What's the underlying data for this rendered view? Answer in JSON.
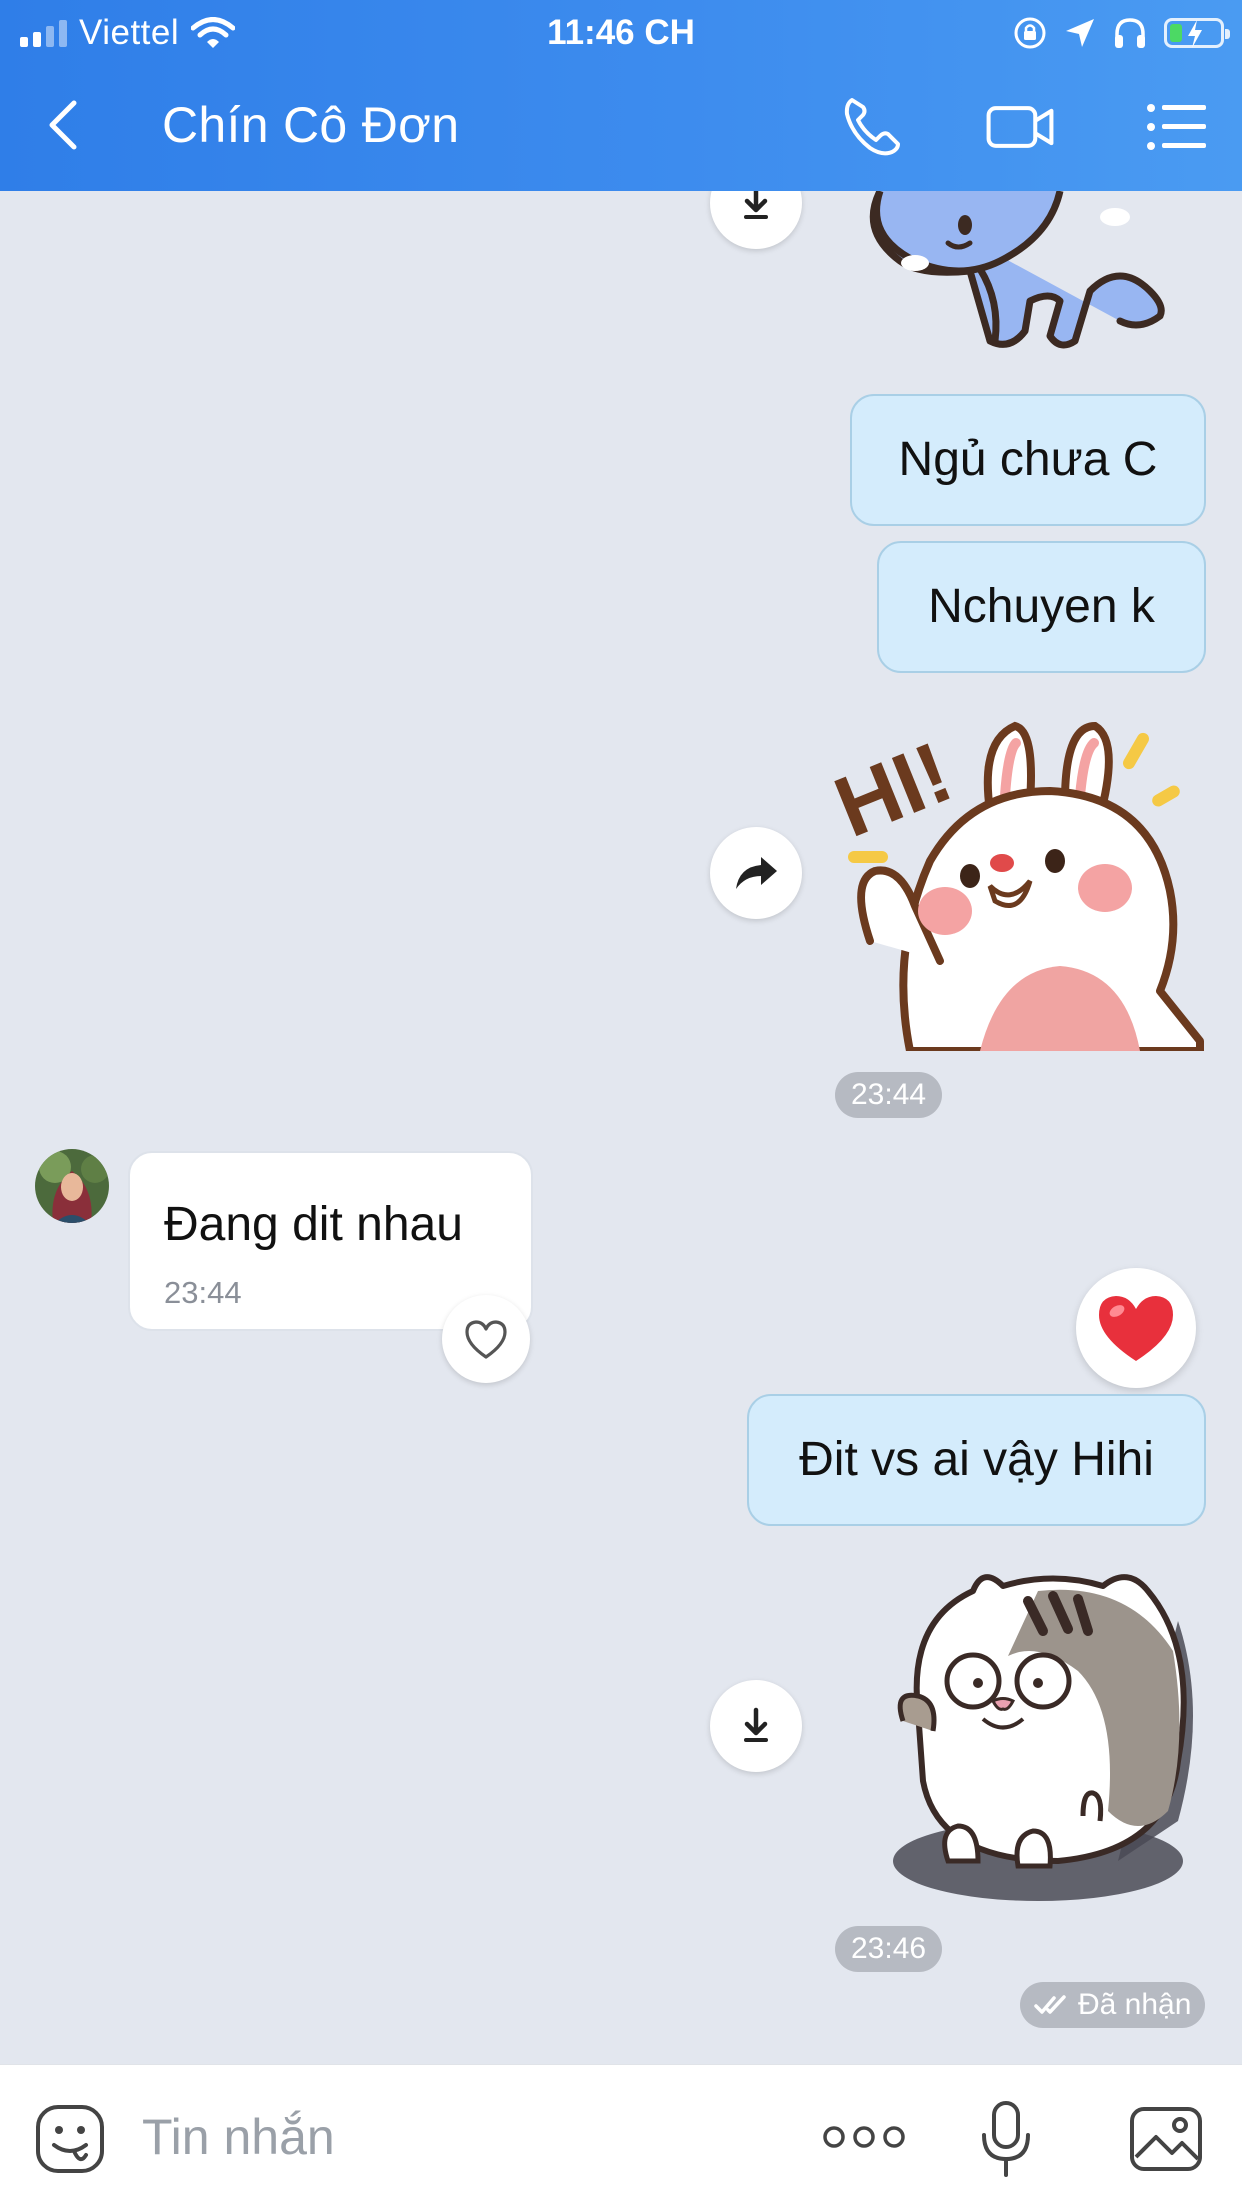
{
  "status_bar": {
    "carrier": "Viettel",
    "time": "11:46 CH"
  },
  "header": {
    "title": "Chín Cô Đơn",
    "icons": [
      "back-icon",
      "phone-icon",
      "video-camera-icon",
      "menu-list-icon"
    ]
  },
  "messages": {
    "out_1": "Ngủ chưa C",
    "out_2": "Nchuyen k",
    "time_1": "23:44",
    "in_1": {
      "text": "Đang dit nhau",
      "time": "23:44"
    },
    "out_3": "Đit vs ai vậy Hihi",
    "time_2": "23:46",
    "delivery_status": "Đã nhận"
  },
  "input_bar": {
    "placeholder": "Tin nhắn",
    "icons": [
      "emoji-icon",
      "more-dots-icon",
      "microphone-icon",
      "image-icon"
    ]
  },
  "colors": {
    "header_start": "#2f7ee8",
    "header_end": "#4a9bf2",
    "chat_background": "#e3e7ef",
    "outgoing_bubble": "#d4ecfc",
    "incoming_bubble": "#ffffff",
    "heart": "#e8303c"
  }
}
